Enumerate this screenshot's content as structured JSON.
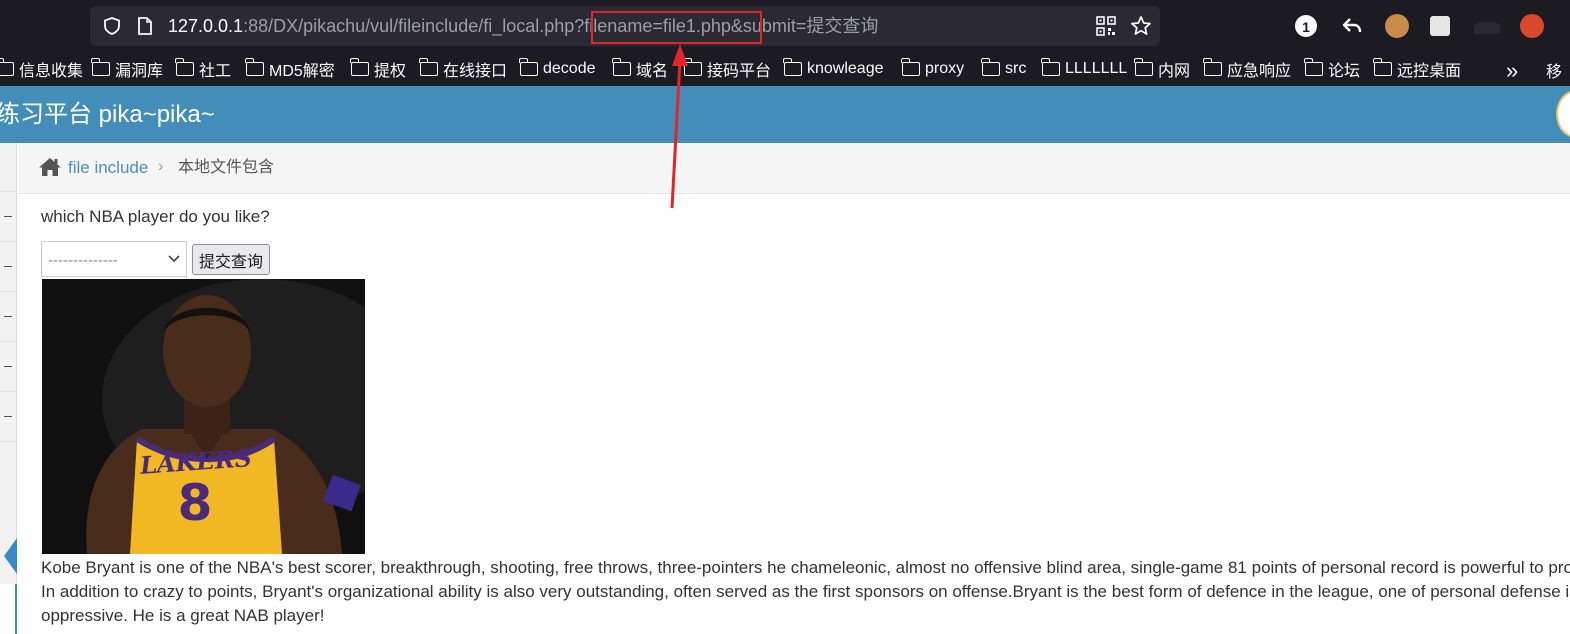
{
  "browser": {
    "url_host": "127.0.0.1",
    "url_rest": ":88/DX/pikachu/vul/fileinclude/fi_local.php?filename=file1.php&submit=提交查询",
    "extension_badge": "1",
    "bookmarks": [
      {
        "label": "信息收集"
      },
      {
        "label": "漏洞库"
      },
      {
        "label": "社工"
      },
      {
        "label": "MD5解密"
      },
      {
        "label": "提权"
      },
      {
        "label": "在线接口"
      },
      {
        "label": "decode"
      },
      {
        "label": "域名"
      },
      {
        "label": "接码平台"
      },
      {
        "label": "knowleage"
      },
      {
        "label": "proxy"
      },
      {
        "label": "src"
      },
      {
        "label": "LLLLLLL"
      },
      {
        "label": "内网"
      },
      {
        "label": "应急响应"
      },
      {
        "label": "论坛"
      },
      {
        "label": "远控桌面"
      }
    ],
    "bookmarks_overflow": "»",
    "bookmark_partial": "移"
  },
  "site": {
    "title": "练习平台 pika~pika~"
  },
  "breadcrumb": {
    "link": "file include",
    "separator": "›",
    "current": "本地文件包含"
  },
  "main": {
    "question": "which NBA player do you like?",
    "select_value": "--------------",
    "submit_label": "提交查询",
    "description": "Kobe Bryant is one of the NBA's best scorer, breakthrough, shooting, free throws, three-pointers he chameleonic, almost no offensive blind area, single-game 81 points of personal record is powerful to prove this. In addition to crazy to points, Bryant's organizational ability is also very outstanding, often served as the first sponsors on offense.Bryant is the best form of defence in the league, one of personal defense is very oppressive. He is a great NAB player!"
  },
  "image": {
    "jersey_text": "LAKERS",
    "jersey_number": "8"
  },
  "colors": {
    "header": "#438eb9",
    "annotation": "#e0262b",
    "browser_bg": "#1c1b22"
  }
}
